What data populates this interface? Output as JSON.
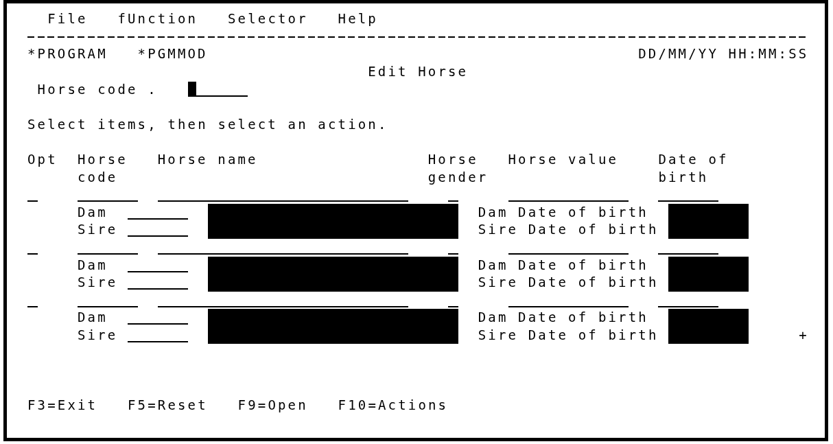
{
  "menu_bar": [
    {
      "label": "File"
    },
    {
      "label": "fUnction"
    },
    {
      "label": "Selector"
    },
    {
      "label": "Help"
    }
  ],
  "header": {
    "program": "*PROGRAM",
    "module": "*PGMMOD",
    "date": "DD/MM/YY",
    "time": "HH:MM:SS"
  },
  "title": "Edit Horse",
  "horse_code_filter": {
    "label": "Horse code .",
    "focused": true
  },
  "instruction": "Select items, then select an action.",
  "list": {
    "columns": [
      {
        "label": "Opt"
      },
      {
        "label": "Horse code"
      },
      {
        "label": "Horse name"
      },
      {
        "label": "Horse gender"
      },
      {
        "label": "Horse value"
      },
      {
        "label": "Date of birth"
      }
    ],
    "rows": [
      {
        "dam_label": "Dam",
        "sire_label": "Sire",
        "dam_birth_label": "Dam Date of birth",
        "sire_birth_label": "Sire Date of birth"
      },
      {
        "dam_label": "Dam",
        "sire_label": "Sire",
        "dam_birth_label": "Dam Date of birth",
        "sire_birth_label": "Sire Date of birth"
      },
      {
        "dam_label": "Dam",
        "sire_label": "Sire",
        "dam_birth_label": "Dam Date of birth",
        "sire_birth_label": "Sire Date of birth"
      }
    ],
    "more_indicator": "+"
  },
  "function_keys": [
    "F3=Exit",
    "F5=Reset",
    "F9=Open",
    "F10=Actions"
  ]
}
